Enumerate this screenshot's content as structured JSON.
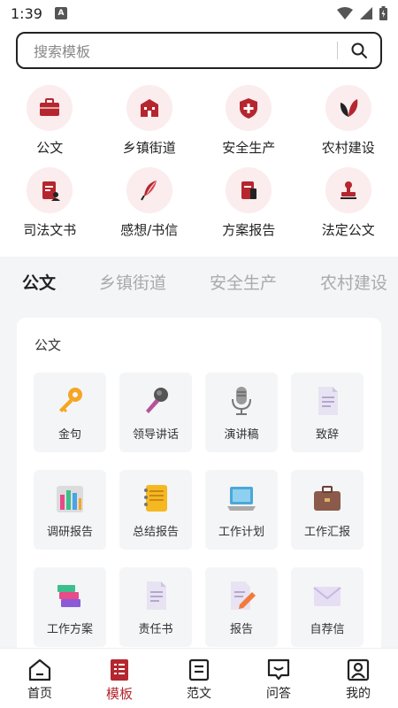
{
  "status_bar": {
    "time": "1:39",
    "notification_letter": "A"
  },
  "search": {
    "placeholder": "搜索模板"
  },
  "categories": [
    {
      "label": "公文",
      "icon": "briefcase-icon"
    },
    {
      "label": "乡镇街道",
      "icon": "building-icon"
    },
    {
      "label": "安全生产",
      "icon": "shield-plus-icon"
    },
    {
      "label": "农村建设",
      "icon": "leaf-icon"
    },
    {
      "label": "司法文书",
      "icon": "legal-document-icon"
    },
    {
      "label": "感想/书信",
      "icon": "quill-icon"
    },
    {
      "label": "方案报告",
      "icon": "report-icon"
    },
    {
      "label": "法定公文",
      "icon": "stamp-icon"
    }
  ],
  "tabs": [
    {
      "label": "公文",
      "active": true
    },
    {
      "label": "乡镇街道",
      "active": false
    },
    {
      "label": "安全生产",
      "active": false
    },
    {
      "label": "农村建设",
      "active": false
    }
  ],
  "card": {
    "title": "公文",
    "items": [
      {
        "label": "金句",
        "icon": "key-icon"
      },
      {
        "label": "领导讲话",
        "icon": "microphone-icon"
      },
      {
        "label": "演讲稿",
        "icon": "studio-mic-icon"
      },
      {
        "label": "致辞",
        "icon": "document-icon"
      },
      {
        "label": "调研报告",
        "icon": "bar-chart-icon"
      },
      {
        "label": "总结报告",
        "icon": "notebook-icon"
      },
      {
        "label": "工作计划",
        "icon": "laptop-icon"
      },
      {
        "label": "工作汇报",
        "icon": "briefcase-icon"
      },
      {
        "label": "工作方案",
        "icon": "books-icon"
      },
      {
        "label": "责任书",
        "icon": "document-icon"
      },
      {
        "label": "报告",
        "icon": "pencil-document-icon"
      },
      {
        "label": "自荐信",
        "icon": "envelope-icon"
      }
    ]
  },
  "bottom_nav": [
    {
      "label": "首页",
      "icon": "home-icon",
      "active": false
    },
    {
      "label": "模板",
      "icon": "template-icon",
      "active": true
    },
    {
      "label": "范文",
      "icon": "article-icon",
      "active": false
    },
    {
      "label": "问答",
      "icon": "chat-icon",
      "active": false
    },
    {
      "label": "我的",
      "icon": "profile-icon",
      "active": false
    }
  ],
  "colors": {
    "accent": "#b5262e",
    "icon_bg": "#fbeced",
    "page_gray": "#f4f5f7"
  }
}
